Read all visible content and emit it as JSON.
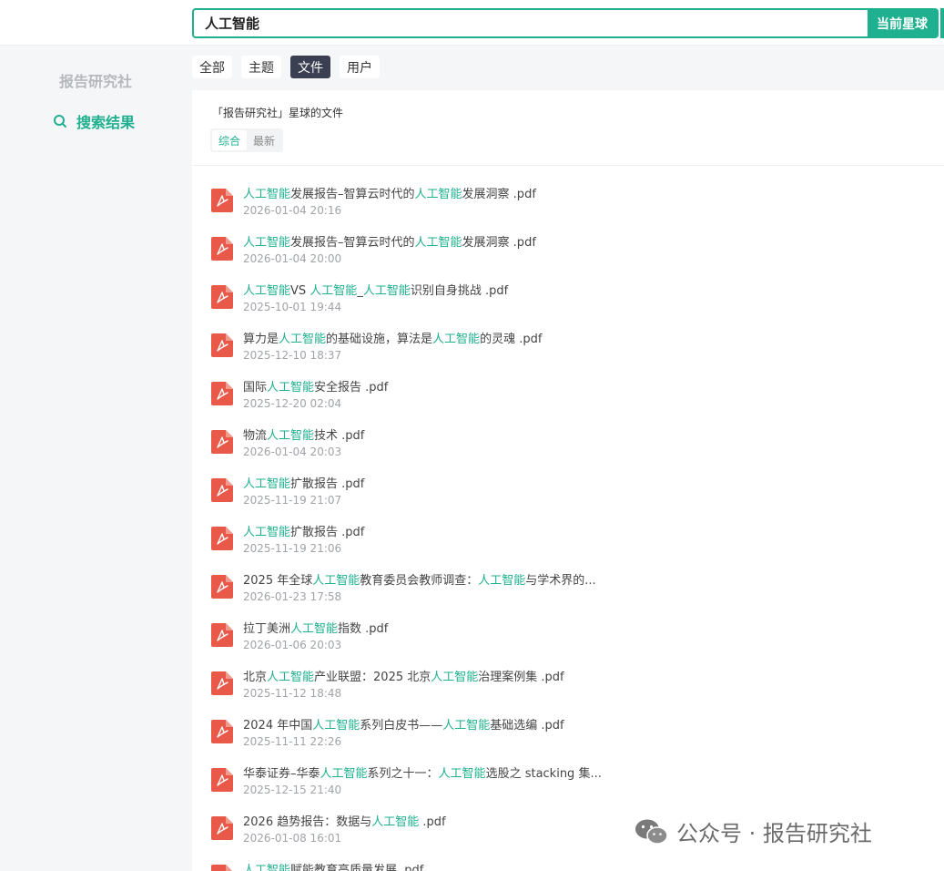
{
  "search": {
    "value": "人工智能",
    "scope_button": "当前星球"
  },
  "sidebar": {
    "title": "报告研究社",
    "nav_label": "搜索结果"
  },
  "tabs": [
    {
      "label": "全部",
      "active": false
    },
    {
      "label": "主题",
      "active": false
    },
    {
      "label": "文件",
      "active": true
    },
    {
      "label": "用户",
      "active": false
    }
  ],
  "panel": {
    "heading": "「报告研究社」星球的文件",
    "sort_options": [
      {
        "label": "综合",
        "active": true
      },
      {
        "label": "最新",
        "active": false
      }
    ]
  },
  "files": [
    {
      "parts": [
        [
          "人工智能",
          true
        ],
        [
          "发展报告–智算云时代的",
          false
        ],
        [
          "人工智能",
          true
        ],
        [
          "发展洞察 .pdf",
          false
        ]
      ],
      "time": "2026-01-04 20:16"
    },
    {
      "parts": [
        [
          "人工智能",
          true
        ],
        [
          "发展报告–智算云时代的",
          false
        ],
        [
          "人工智能",
          true
        ],
        [
          "发展洞察 .pdf",
          false
        ]
      ],
      "time": "2026-01-04 20:00"
    },
    {
      "parts": [
        [
          "人工智能",
          true
        ],
        [
          "VS ",
          false
        ],
        [
          "人工智能",
          true
        ],
        [
          "_",
          false
        ],
        [
          "人工智能",
          true
        ],
        [
          "识别自身挑战 .pdf",
          false
        ]
      ],
      "time": "2025-10-01 19:44"
    },
    {
      "parts": [
        [
          "算力是",
          false
        ],
        [
          "人工智能",
          true
        ],
        [
          "的基础设施，算法是",
          false
        ],
        [
          "人工智能",
          true
        ],
        [
          "的灵魂 .pdf",
          false
        ]
      ],
      "time": "2025-12-10 18:37"
    },
    {
      "parts": [
        [
          "国际",
          false
        ],
        [
          "人工智能",
          true
        ],
        [
          "安全报告 .pdf",
          false
        ]
      ],
      "time": "2025-12-20 02:04"
    },
    {
      "parts": [
        [
          "物流",
          false
        ],
        [
          "人工智能",
          true
        ],
        [
          "技术 .pdf",
          false
        ]
      ],
      "time": "2026-01-04 20:03"
    },
    {
      "parts": [
        [
          "人工智能",
          true
        ],
        [
          "扩散报告 .pdf",
          false
        ]
      ],
      "time": "2025-11-19 21:07"
    },
    {
      "parts": [
        [
          "人工智能",
          true
        ],
        [
          "扩散报告 .pdf",
          false
        ]
      ],
      "time": "2025-11-19 21:06"
    },
    {
      "parts": [
        [
          "2025 年全球",
          false
        ],
        [
          "人工智能",
          true
        ],
        [
          "教育委员会教师调查：",
          false
        ],
        [
          "人工智能",
          true
        ],
        [
          "与学术界的...",
          false
        ]
      ],
      "time": "2026-01-23 17:58"
    },
    {
      "parts": [
        [
          "拉丁美洲",
          false
        ],
        [
          "人工智能",
          true
        ],
        [
          "指数 .pdf",
          false
        ]
      ],
      "time": "2026-01-06 20:03"
    },
    {
      "parts": [
        [
          "北京",
          false
        ],
        [
          "人工智能",
          true
        ],
        [
          "产业联盟：2025 北京",
          false
        ],
        [
          "人工智能",
          true
        ],
        [
          "治理案例集 .pdf",
          false
        ]
      ],
      "time": "2025-11-12 18:48"
    },
    {
      "parts": [
        [
          "2024 年中国",
          false
        ],
        [
          "人工智能",
          true
        ],
        [
          "系列白皮书——",
          false
        ],
        [
          "人工智能",
          true
        ],
        [
          "基础选编 .pdf",
          false
        ]
      ],
      "time": "2025-11-11 22:26"
    },
    {
      "parts": [
        [
          "华泰证券–华泰",
          false
        ],
        [
          "人工智能",
          true
        ],
        [
          "系列之十一：",
          false
        ],
        [
          "人工智能",
          true
        ],
        [
          "选股之 stacking 集...",
          false
        ]
      ],
      "time": "2025-12-15 21:40"
    },
    {
      "parts": [
        [
          "2026 趋势报告：数据与",
          false
        ],
        [
          "人工智能",
          true
        ],
        [
          " .pdf",
          false
        ]
      ],
      "time": "2026-01-08 16:01"
    },
    {
      "parts": [
        [
          "人工智能",
          true
        ],
        [
          "赋能教育高质量发展 .pdf",
          false
        ]
      ],
      "time": ""
    }
  ],
  "watermark": "公众号 · 报告研究社",
  "colors": {
    "accent": "#1fb08f",
    "pdf": "#e8594a",
    "active_tab": "#3a3f52"
  }
}
